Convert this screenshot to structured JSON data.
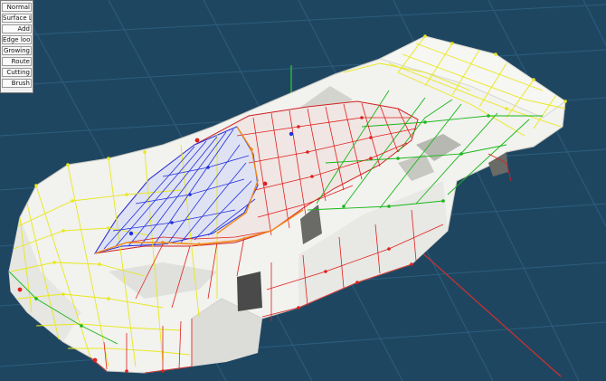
{
  "mode_menu": {
    "items": [
      {
        "label": "Normal"
      },
      {
        "label": "Surface Level"
      },
      {
        "label": "Add"
      },
      {
        "label": "Edge loop"
      },
      {
        "label": "Growing"
      },
      {
        "label": "Route"
      },
      {
        "label": "Cutting"
      },
      {
        "label": "Brush"
      }
    ]
  },
  "viewport": {
    "background": "#1f4661",
    "grid_color": "#2f6283",
    "model_color": "#f4f4f2",
    "wire_colors": {
      "yellow": "#e8e81c",
      "red": "#e0201c",
      "blue": "#2030e0",
      "green": "#18b818",
      "orange": "#f08a18"
    }
  }
}
